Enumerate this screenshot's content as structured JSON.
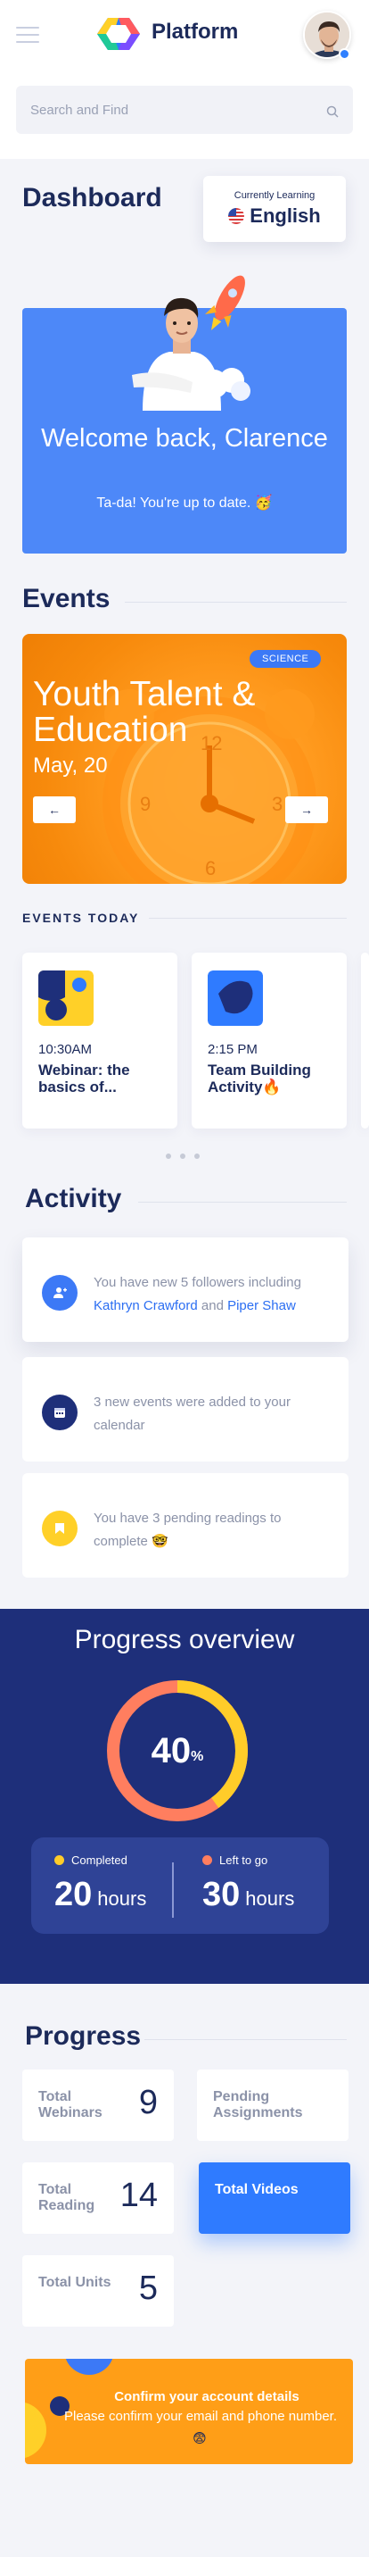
{
  "header": {
    "brand": "Platform"
  },
  "search": {
    "placeholder": "Search and Find"
  },
  "dashboard": {
    "title": "Dashboard",
    "learning_caption": "Currently Learning",
    "language": "English"
  },
  "welcome": {
    "title": "Welcome back, Clarence",
    "subtitle": "Ta-da! You're up to date. 🥳"
  },
  "events": {
    "title": "Events",
    "banner": {
      "tag": "SCIENCE",
      "title": "Youth Talent & Education",
      "date": "May, 20",
      "prev_icon": "←",
      "next_icon": "→"
    },
    "today_title": "EVENTS TODAY",
    "today": [
      {
        "time": "10:30AM",
        "title": "Webinar: the basics of..."
      },
      {
        "time": "2:15 PM",
        "title": "Team Building Activity🔥"
      }
    ]
  },
  "activity": {
    "title": "Activity",
    "items": [
      {
        "prefix": "You have new 5 followers including ",
        "name1": "Kathryn Crawford",
        "mid": " and ",
        "name2": "Piper Shaw",
        "icon": "user-add-icon",
        "color": "#3c79f6"
      },
      {
        "text": "3 new events were added to your calendar",
        "icon": "calendar-icon",
        "color": "#1e2f7a"
      },
      {
        "text": "You have 3 pending readings to complete 🤓",
        "icon": "bookmark-icon",
        "color": "#ffd028"
      }
    ]
  },
  "overview": {
    "title": "Progress overview",
    "percent": "40",
    "percent_sign": "%",
    "percent_value": 40,
    "completed_label": "Completed",
    "completed_value": "20",
    "left_label": "Left to go",
    "left_value": "30",
    "unit": "hours",
    "colors": {
      "completed": "#ffcc29",
      "left": "#ff7e5f"
    }
  },
  "progress": {
    "title": "Progress",
    "cards": [
      {
        "label": "Total Webinars",
        "value": "9"
      },
      {
        "label": "Pending Assignments",
        "value": ""
      },
      {
        "label": "Total Reading",
        "value": "14"
      },
      {
        "label": "Total Videos",
        "value": ""
      },
      {
        "label": "Total Units",
        "value": "5"
      }
    ]
  },
  "confirm": {
    "title": "Confirm your account details",
    "body": "Please confirm your email and phone number.",
    "emoji": "😨"
  }
}
